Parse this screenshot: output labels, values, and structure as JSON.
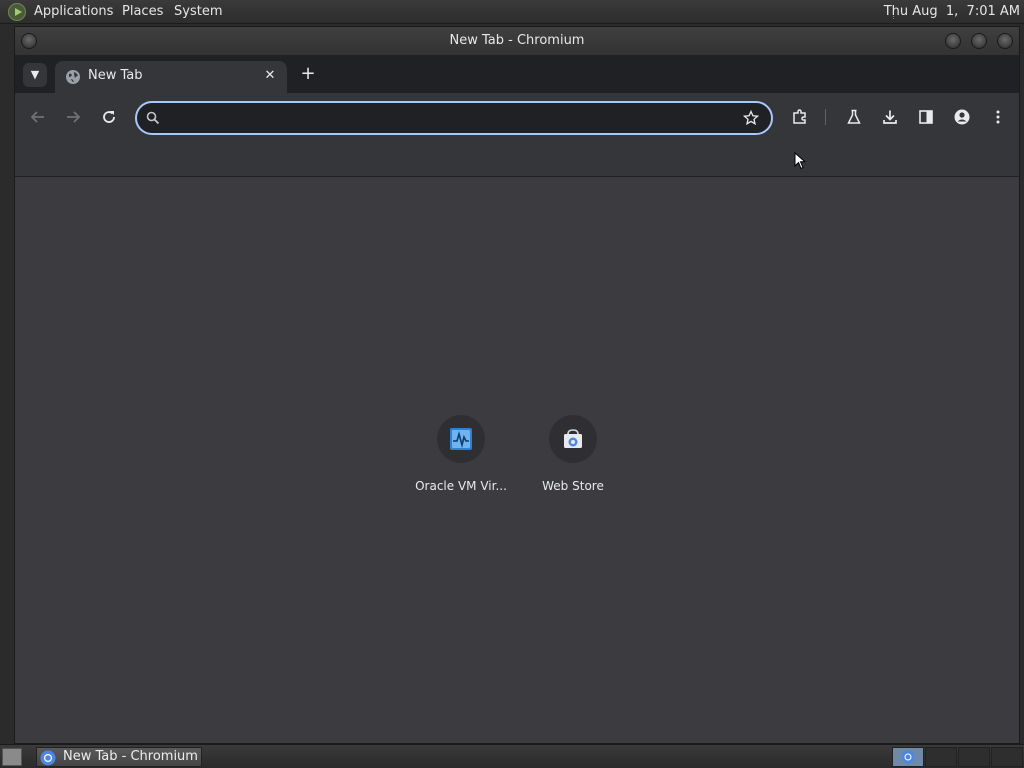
{
  "top_panel": {
    "menus": [
      "Applications",
      "Places",
      "System"
    ],
    "clock": "Thu Aug  1,  7:01 AM"
  },
  "window": {
    "title": "New Tab - Chromium"
  },
  "tabs": [
    {
      "label": "New Tab",
      "active": true
    }
  ],
  "omnibox": {
    "value": "",
    "placeholder": ""
  },
  "shortcuts": [
    {
      "label": "Oracle VM Vir...",
      "icon": "virtualbox-icon"
    },
    {
      "label": "Web Store",
      "icon": "web-store-icon"
    }
  ],
  "taskbar": {
    "task_label": "New Tab - Chromium"
  },
  "colors": {
    "accent": "#a8c7fa",
    "tab_strip": "#202124",
    "toolbar": "#35363a",
    "content": "#3c3c40"
  }
}
